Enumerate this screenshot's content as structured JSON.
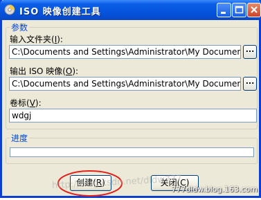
{
  "window": {
    "title": "ISO 映像创建工具"
  },
  "titlebar_buttons": [
    "minimize",
    "maximize",
    "close"
  ],
  "params_group": {
    "title": "参数",
    "input_folder": {
      "label_prefix": "输入文件夹(",
      "accel": "I",
      "label_suffix": "):",
      "value": "C:\\Documents and Settings\\Administrator\\My Documents\\新建文件夹",
      "browse_label": "..."
    },
    "output_iso": {
      "label_prefix": "输出 ISO 映像(",
      "accel": "O",
      "label_suffix": "):",
      "value": "C:\\Documents and Settings\\Administrator\\My Documents\\新建文件夹",
      "browse_label": "..."
    },
    "volume_label": {
      "label_prefix": "卷标(",
      "accel": "V",
      "label_suffix": "):",
      "value": "wdgj"
    }
  },
  "progress_group": {
    "title": "进度",
    "value": 0
  },
  "buttons": {
    "create": {
      "prefix": "创建(",
      "accel": "R",
      "suffix": ")"
    },
    "close": {
      "prefix": "关闭(",
      "accel": "C",
      "suffix": ")"
    }
  },
  "overlay": {
    "watermark": "http://blog.csdn.net/dldw777",
    "corner_mark": "777dldw.blog.163.com",
    "highlight_color": "#e0201a"
  }
}
